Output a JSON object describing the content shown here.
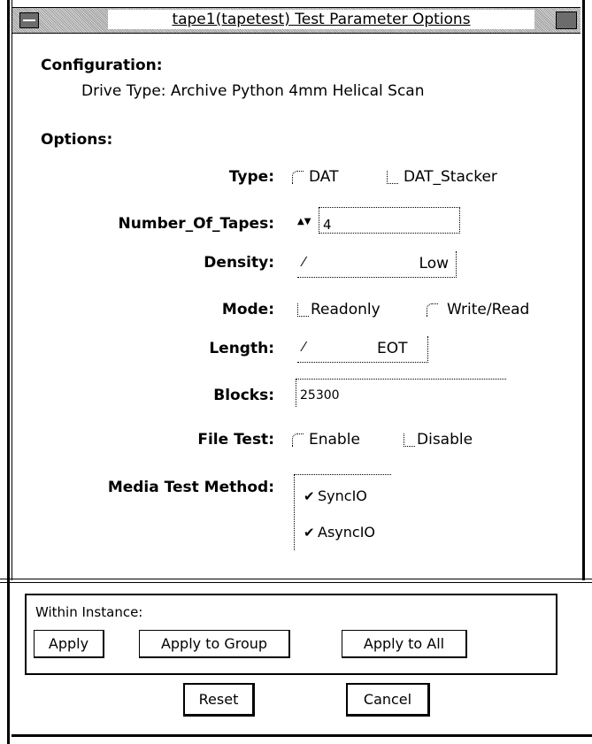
{
  "window": {
    "title": "tape1(tapetest) Test Parameter Options"
  },
  "configuration": {
    "heading": "Configuration:",
    "drive_type": "Drive Type: Archive Python 4mm Helical Scan"
  },
  "options": {
    "heading": "Options:",
    "type": {
      "label": "Type:",
      "choices": [
        "DAT",
        "DAT_Stacker"
      ]
    },
    "number_of_tapes": {
      "label": "Number_Of_Tapes:",
      "value": "4"
    },
    "density": {
      "label": "Density:",
      "value": "Low"
    },
    "mode": {
      "label": "Mode:",
      "choices": [
        "Readonly",
        "Write/Read"
      ]
    },
    "length": {
      "label": "Length:",
      "value": "EOT"
    },
    "blocks": {
      "label": "Blocks:",
      "value": "25300"
    },
    "file_test": {
      "label": "File Test:",
      "choices": [
        "Enable",
        "Disable"
      ]
    },
    "media_test_method": {
      "label": "Media Test Method:",
      "choices": [
        "SyncIO",
        "AsyncIO"
      ]
    }
  },
  "within_instance": {
    "label": "Within Instance:",
    "apply": "Apply",
    "apply_group": "Apply to Group",
    "apply_all": "Apply to All"
  },
  "footer": {
    "reset": "Reset",
    "cancel": "Cancel"
  },
  "icons": {
    "check": "✔",
    "stepper_up": "▲",
    "stepper_down": "▼",
    "menu_caret": "⁄"
  }
}
